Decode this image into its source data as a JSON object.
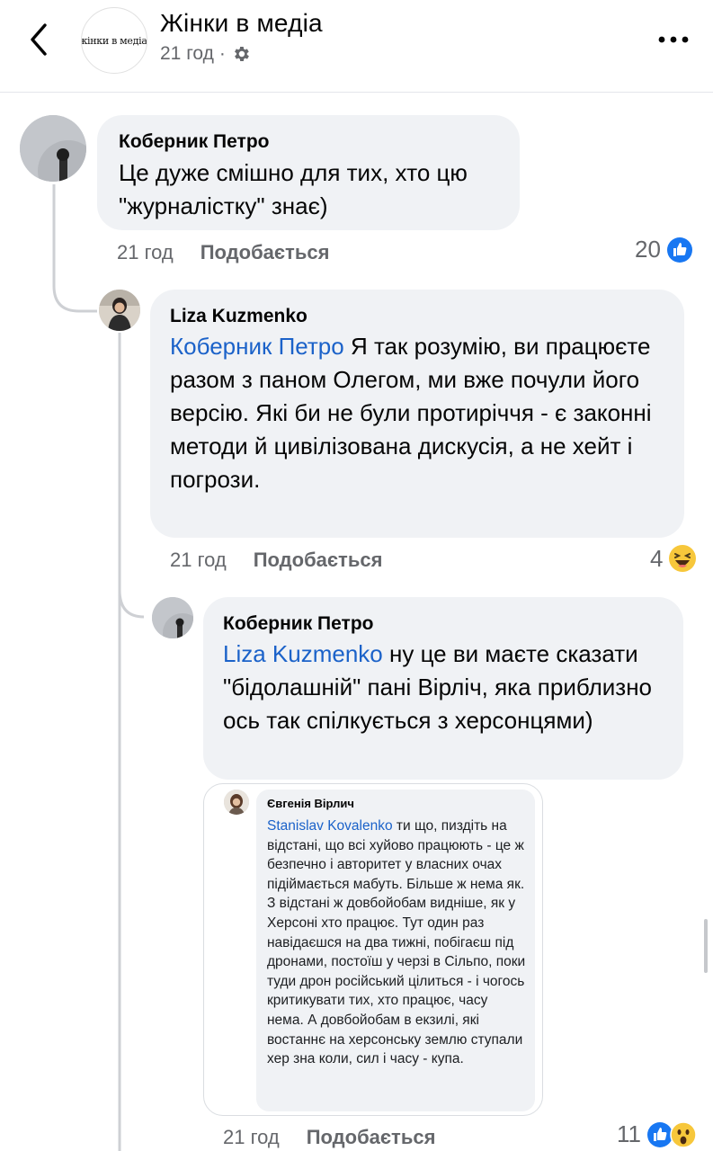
{
  "header": {
    "title": "Жінки в медіа",
    "logo_text": "жінки в медіа.",
    "time": "21 год",
    "separator": "·"
  },
  "comments": [
    {
      "author": "Коберник Петро",
      "text": "Це дуже смішно для тих, хто цю \"журналістку\" знає)",
      "time": "21 год",
      "like_label": "Подобається",
      "reaction_count": "20",
      "reactions": [
        "like-icon"
      ]
    },
    {
      "author": "Liza Kuzmenko",
      "mention": "Коберник Петро",
      "text": " Я так розумію, ви працюєте разом з паном Олегом, ми вже почули його версію. Які би не були протиріччя - є законні методи й цивілізована дискусія, а не хейт і погрози.",
      "time": "21 год",
      "like_label": "Подобається",
      "reaction_count": "4",
      "reactions": [
        "haha-icon"
      ]
    },
    {
      "author": "Коберник Петро",
      "mention": "Liza Kuzmenko",
      "text": " ну це ви маєте сказати \"бідолашній\" пані Вірліч, яка приблизно ось так спілкується з херсонцями)",
      "time": "21 год",
      "like_label": "Подобається",
      "reaction_count": "11",
      "reactions": [
        "like-icon",
        "wow-icon"
      ],
      "attachment": {
        "author": "Євгенія Вірлич",
        "mention": "Stanislav Kovalenko",
        "text": " ти що, пиздіть на відстані, що всі хуйово працюють - це ж безпечно і авторитет у власних очах підіймається мабуть. Більше ж нема як. З відстані ж довбойобам видніше, як у Херсоні хто працює. Тут один раз навідаєшся на два тижні, побігаєш під дронами, постоїш у черзі в Сільпо, поки туди дрон російський цілиться - і чогось критикувати тих, хто працює, часу нема. А довбойобам в екзилі, які востаннє на херсонську землю ступали хер зна коли, сил і часу - купа."
      }
    }
  ],
  "colors": {
    "link": "#1b62c9",
    "bubble": "#f0f2f5",
    "meta": "#65676b",
    "like_blue": "#1877f2",
    "emoji_yellow": "#f7c73b"
  }
}
